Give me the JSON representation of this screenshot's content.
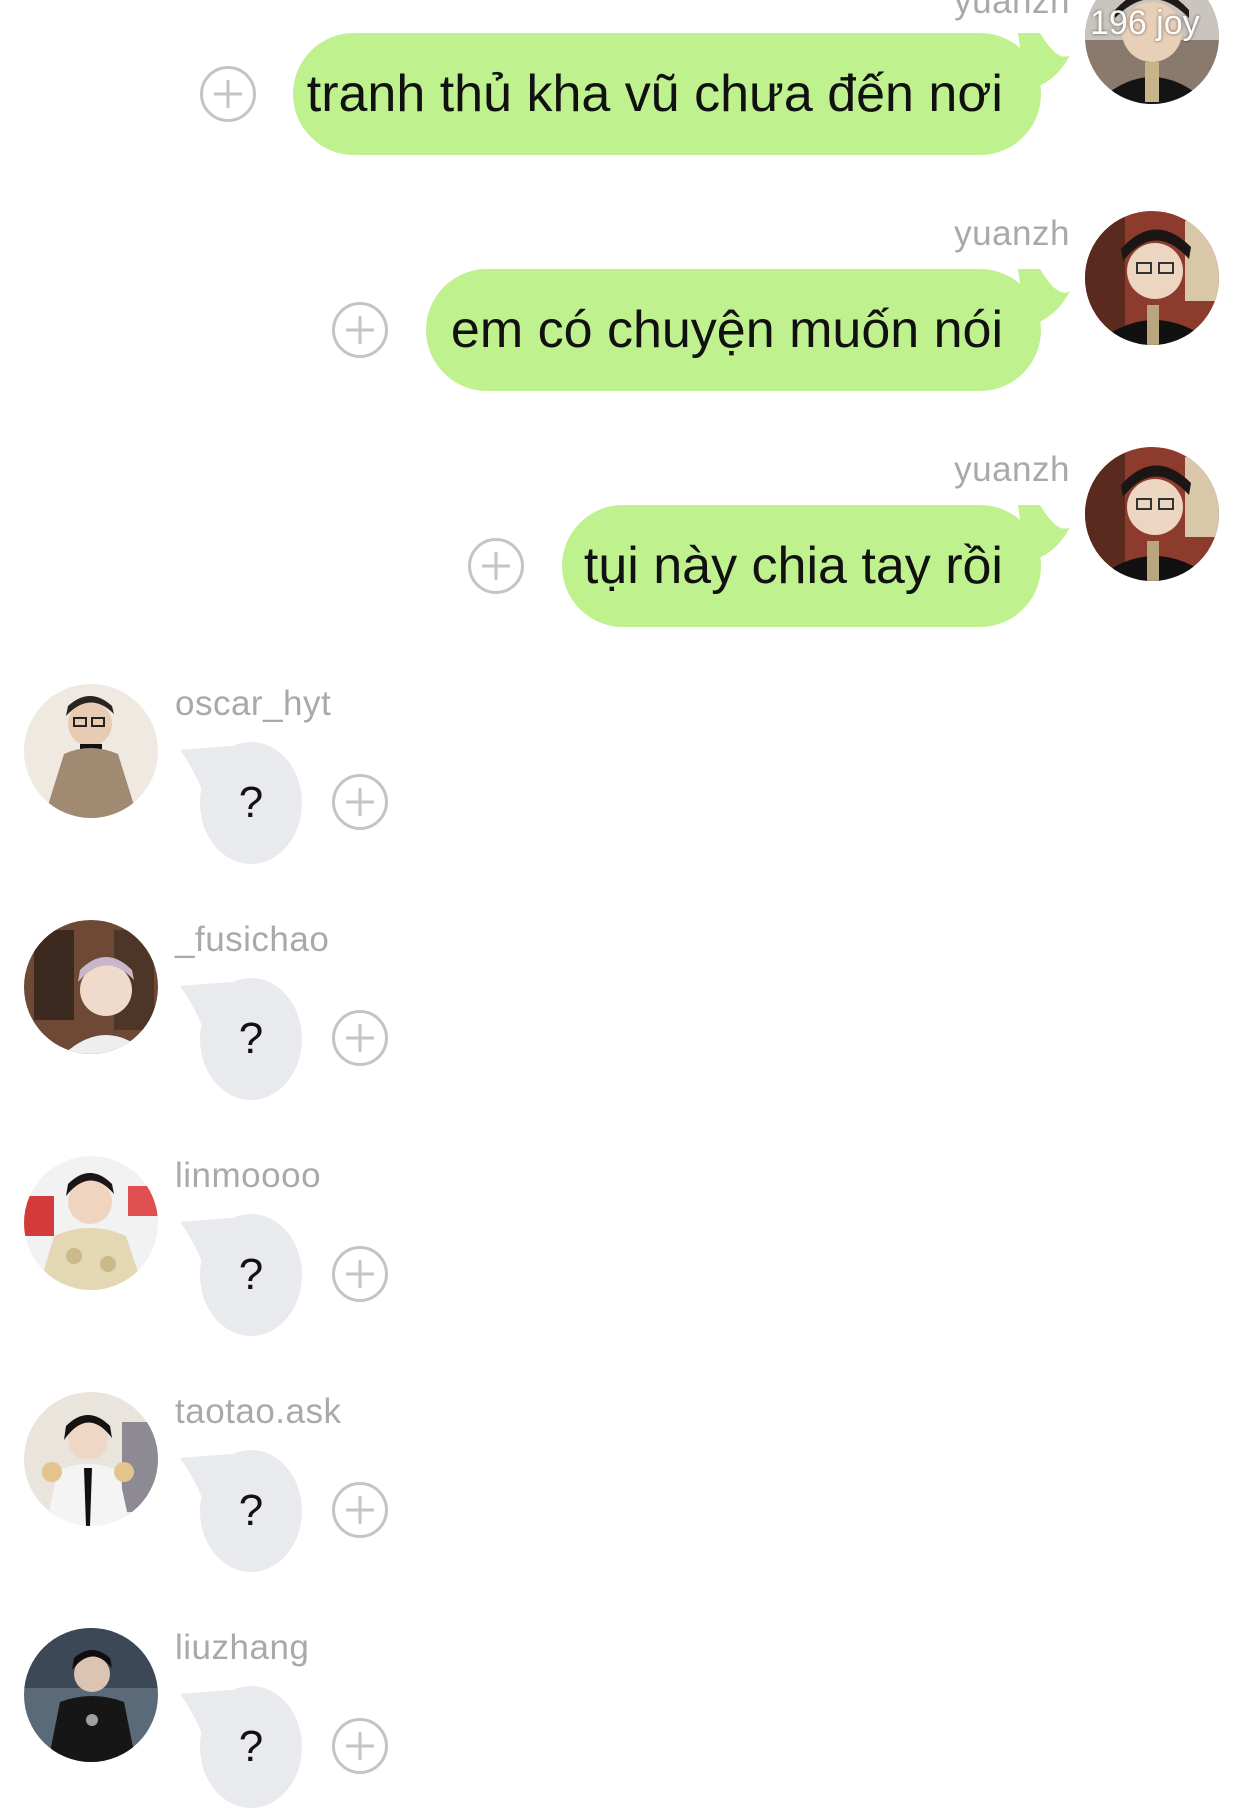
{
  "outgoing": [
    {
      "username": "yuanzh",
      "text": "tranh thủ kha vũ chưa đến nơi"
    },
    {
      "username": "yuanzh",
      "text": "em có chuyện muốn nói"
    },
    {
      "username": "yuanzh",
      "text": "tụi này chia tay rồi"
    }
  ],
  "incoming": [
    {
      "username": "oscar_hyt",
      "text": "?"
    },
    {
      "username": "_fusichao",
      "text": "?"
    },
    {
      "username": "linmoooo",
      "text": "?"
    },
    {
      "username": "taotao.ask",
      "text": "?"
    },
    {
      "username": "liuzhang",
      "text": "?"
    }
  ],
  "watermark": "196 joy",
  "icons": {
    "add": "plus-circle-icon"
  },
  "colors": {
    "outgoing_bubble": "#bff28f",
    "incoming_bubble": "#e8eaed",
    "username": "#a9a9a9"
  }
}
